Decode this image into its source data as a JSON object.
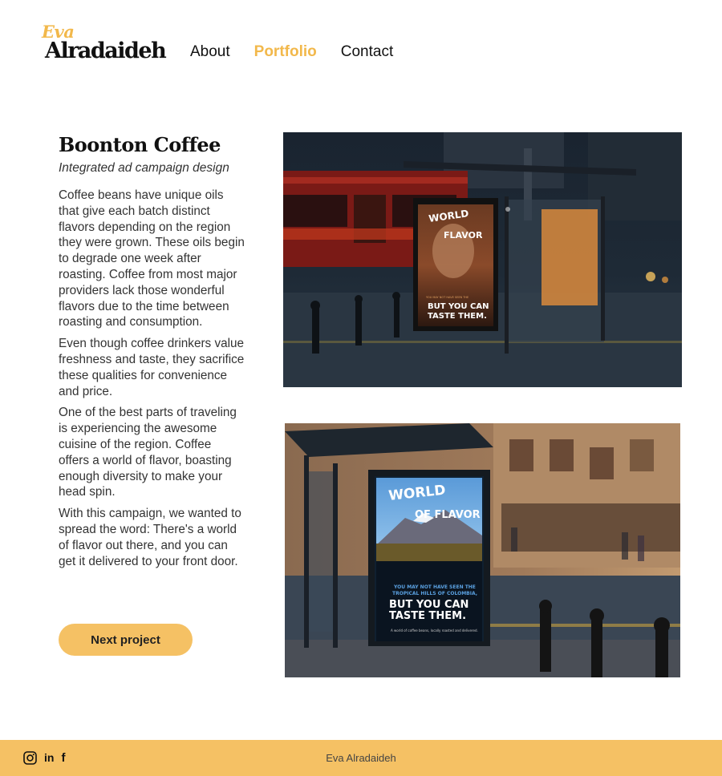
{
  "header": {
    "logo_first": "Eva",
    "logo_last": "Alradaideh",
    "nav": [
      {
        "label": "About"
      },
      {
        "label": "Portfolio",
        "active": true
      },
      {
        "label": "Contact"
      }
    ]
  },
  "project": {
    "title": "Boonton Coffee",
    "subtitle": "Integrated ad campaign design",
    "paragraphs": [
      "Coffee beans have unique oils that give each batch distinct flavors depending on the region they were grown. These oils begin to degrade one week after roasting. Coffee from most major providers lack those wonderful flavors due to the time between roasting and consumption.",
      "Even though coffee drinkers value freshness and taste, they sacrifice these qualities for convenience and price.",
      "One of the best parts of traveling is experiencing the awesome cuisine of the region. Coffee offers a world of flavor, boasting enough diversity to make your head spin.",
      "With this campaign, we wanted to spread the word: There's a world of flavor out there, and you can get it delivered to your front door."
    ],
    "next_label": "Next project"
  },
  "images": {
    "poster1": {
      "headline": "A WORLD OF FLAVOR",
      "line_small": "YOU MAY NOT HAVE SEEN THE ANCIENT RUINS OF ETHIOPIA,",
      "line_big_1": "BUT YOU CAN",
      "line_big_2": "TASTE THEM."
    },
    "poster2": {
      "headline_1": "A WORLD",
      "headline_2": "OF FLAVOR",
      "line_small_1": "YOU MAY NOT HAVE SEEN THE",
      "line_small_2": "TROPICAL HILLS OF COLOMBIA,",
      "line_big_1": "BUT YOU CAN",
      "line_big_2": "TASTE THEM.",
      "footer_line": "A world of coffee beans, locally roasted and delivered."
    }
  },
  "footer": {
    "name": "Eva Alradaideh",
    "social": [
      "instagram-icon",
      "linkedin-icon",
      "facebook-icon"
    ]
  },
  "colors": {
    "accent": "#f2b84b",
    "button": "#f5c164",
    "footer_bg": "#f5c164",
    "text": "#111111"
  }
}
